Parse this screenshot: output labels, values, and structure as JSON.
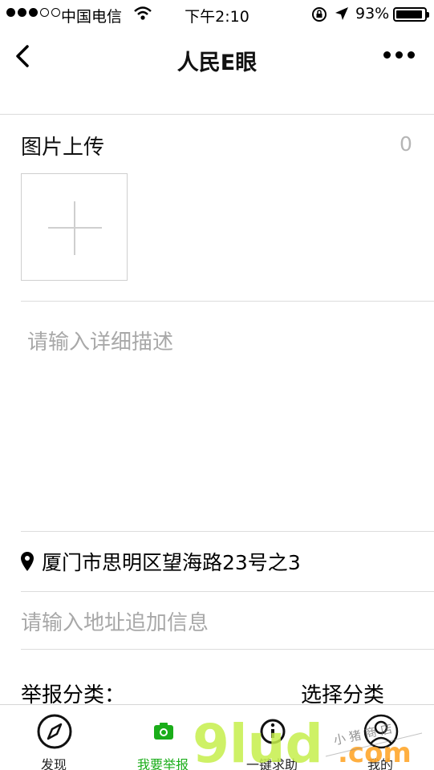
{
  "status_bar": {
    "carrier": "中国电信",
    "time": "下午2:10",
    "battery": "93%",
    "battery_level": 0.93,
    "signal_bars": 3,
    "signal_total": 5
  },
  "nav": {
    "title": "人民E眼",
    "back_icon": "chevron-left-icon",
    "more_icon": "more-dots-icon"
  },
  "upload": {
    "label": "图片上传",
    "count": "0",
    "add_icon": "plus-icon"
  },
  "description": {
    "placeholder": "请输入详细描述"
  },
  "location": {
    "icon": "location-pin-icon",
    "address": "厦门市思明区望海路23号之3"
  },
  "address_extra": {
    "placeholder": "请输入地址追加信息"
  },
  "category": {
    "label": "举报分类：",
    "value": "选择分类"
  },
  "tabbar": {
    "tabs": [
      {
        "label": "发现",
        "icon": "compass-icon"
      },
      {
        "label": "我要举报",
        "icon": "camera-icon",
        "active": true
      },
      {
        "label": "一键求助",
        "icon": "info-icon"
      },
      {
        "label": "我的",
        "icon": "user-icon"
      }
    ]
  },
  "watermark": {
    "logo": "9lud.com",
    "tagline": "小猪商店"
  },
  "colors": {
    "active_tab": "#1aad19",
    "placeholder": "#a8a8a8",
    "divider": "#dcdcdc"
  }
}
